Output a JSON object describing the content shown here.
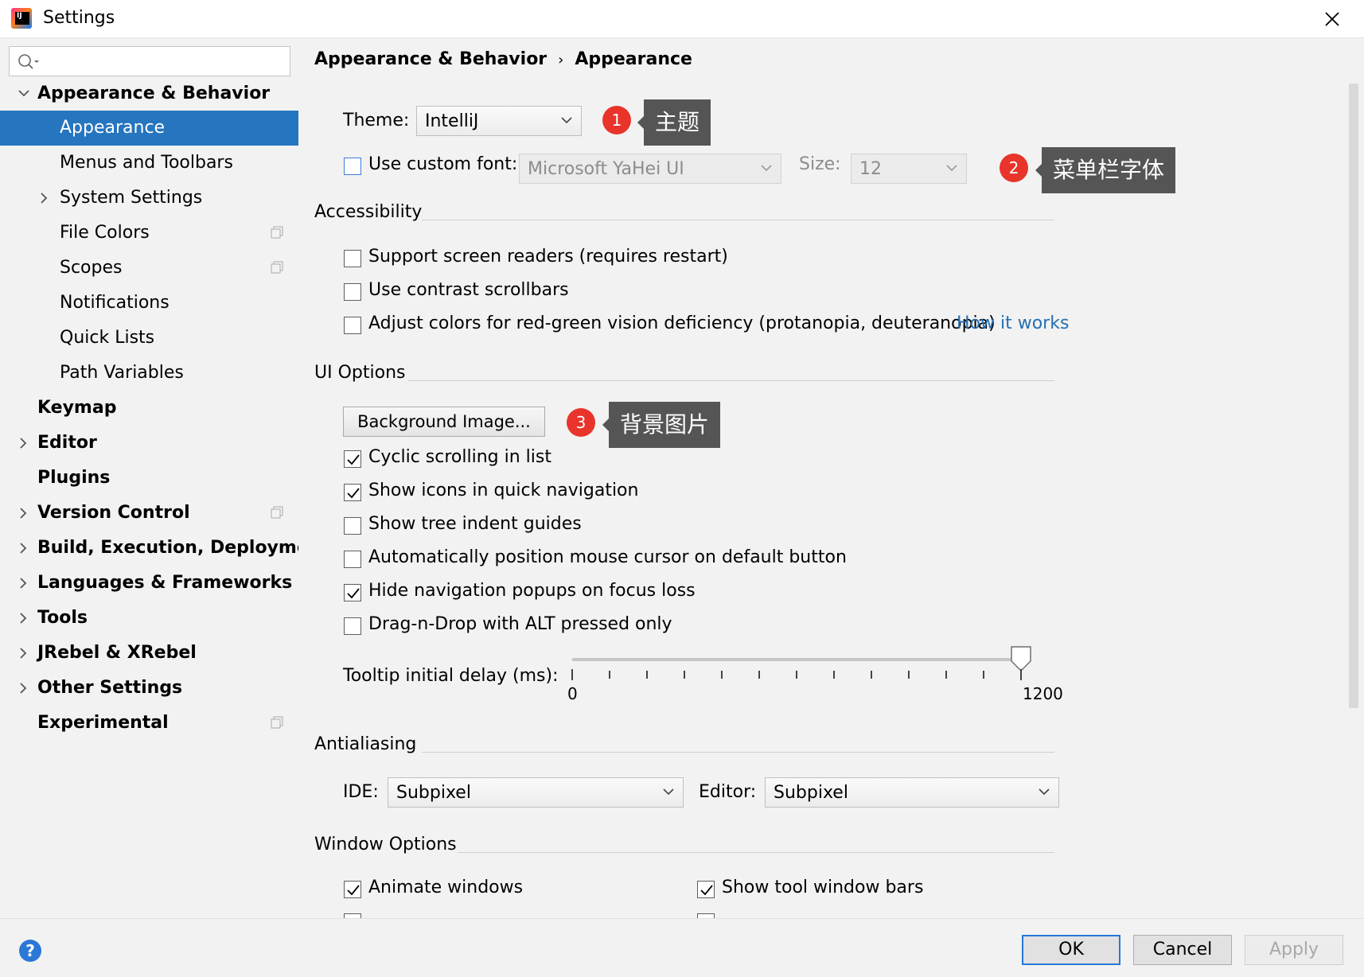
{
  "window": {
    "title": "Settings"
  },
  "search": {
    "placeholder": ""
  },
  "sidebar": {
    "items": [
      {
        "label": "Appearance & Behavior"
      },
      {
        "label": "Appearance"
      },
      {
        "label": "Menus and Toolbars"
      },
      {
        "label": "System Settings"
      },
      {
        "label": "File Colors"
      },
      {
        "label": "Scopes"
      },
      {
        "label": "Notifications"
      },
      {
        "label": "Quick Lists"
      },
      {
        "label": "Path Variables"
      },
      {
        "label": "Keymap"
      },
      {
        "label": "Editor"
      },
      {
        "label": "Plugins"
      },
      {
        "label": "Version Control"
      },
      {
        "label": "Build, Execution, Deployment"
      },
      {
        "label": "Languages & Frameworks"
      },
      {
        "label": "Tools"
      },
      {
        "label": "JRebel & XRebel"
      },
      {
        "label": "Other Settings"
      },
      {
        "label": "Experimental"
      }
    ]
  },
  "breadcrumb": {
    "parent": "Appearance & Behavior",
    "separator": "›",
    "current": "Appearance"
  },
  "theme": {
    "label": "Theme:",
    "value": "IntelliJ"
  },
  "custom_font": {
    "label": "Use custom font:",
    "value": "Microsoft YaHei UI",
    "size_label": "Size:",
    "size_value": "12",
    "checked": false
  },
  "callouts": [
    {
      "num": "1",
      "text": "主题"
    },
    {
      "num": "2",
      "text": "菜单栏字体"
    },
    {
      "num": "3",
      "text": "背景图片"
    }
  ],
  "accessibility": {
    "title": "Accessibility",
    "options": [
      {
        "label": "Support screen readers (requires restart)",
        "checked": false
      },
      {
        "label": "Use contrast scrollbars",
        "checked": false
      },
      {
        "label": "Adjust colors for red-green vision deficiency (protanopia, deuteranopia)",
        "checked": false
      }
    ],
    "link": "How it works"
  },
  "ui_options": {
    "title": "UI Options",
    "background_button": "Background Image...",
    "options": [
      {
        "label": "Cyclic scrolling in list",
        "checked": true
      },
      {
        "label": "Show icons in quick navigation",
        "checked": true
      },
      {
        "label": "Show tree indent guides",
        "checked": false
      },
      {
        "label": "Automatically position mouse cursor on default button",
        "checked": false
      },
      {
        "label": "Hide navigation popups on focus loss",
        "checked": true
      },
      {
        "label": "Drag-n-Drop with ALT pressed only",
        "checked": false
      }
    ],
    "tooltip": {
      "label": "Tooltip initial delay (ms):",
      "min": "0",
      "max": "1200",
      "value": 1200
    }
  },
  "antialiasing": {
    "title": "Antialiasing",
    "ide_label": "IDE:",
    "ide_value": "Subpixel",
    "editor_label": "Editor:",
    "editor_value": "Subpixel"
  },
  "window_options": {
    "title": "Window Options",
    "options": [
      {
        "label": "Animate windows",
        "checked": true
      },
      {
        "label": "Show tool window bars",
        "checked": true
      }
    ]
  },
  "buttons": {
    "ok": "OK",
    "cancel": "Cancel",
    "apply": "Apply",
    "help": "?"
  },
  "colors": {
    "selection": "#2675bf",
    "callout_red": "#e8342b",
    "callout_bg": "#555555",
    "link": "#2470b3"
  }
}
